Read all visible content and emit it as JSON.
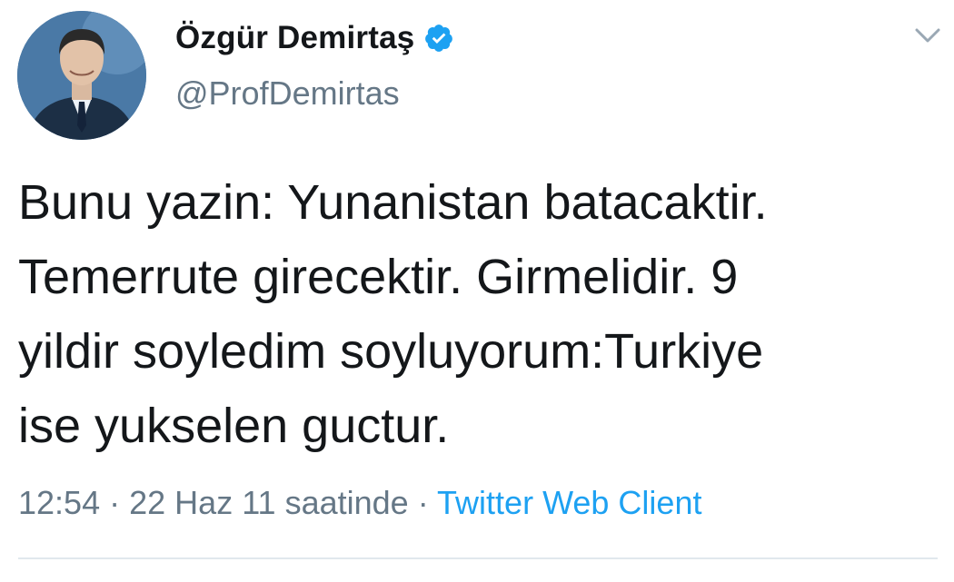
{
  "user": {
    "display_name": "Özgür Demirtaş",
    "handle": "@ProfDemirtas",
    "verified": true,
    "verified_badge_color": "#1da1f2",
    "avatar_icon": "profile-photo"
  },
  "tweet": {
    "text": "Bunu yazin: Yunanistan batacaktir.\nTemerrute girecektir. Girmelidir. 9\nyildir soyledim soyluyorum:Turkiye\nise yukselen guctur.",
    "time": "12:54",
    "separator": "·",
    "date": "22 Haz 11 saatinde",
    "source": "Twitter Web Client"
  },
  "actions": {
    "menu_icon": "chevron-down-icon"
  },
  "colors": {
    "text": "#14171a",
    "muted": "#657786",
    "link": "#1da1f2",
    "divider": "#e1e8ed"
  }
}
